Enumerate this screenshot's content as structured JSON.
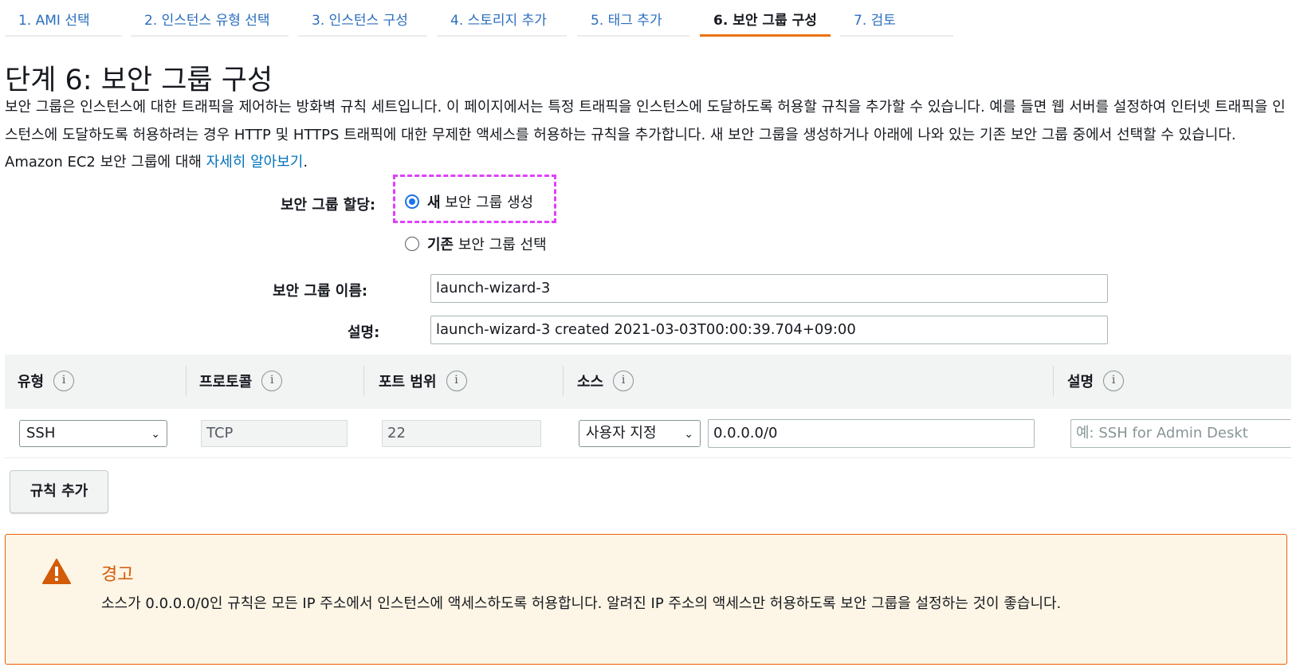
{
  "wizard": {
    "steps": [
      {
        "label": "1. AMI 선택",
        "active": false
      },
      {
        "label": "2. 인스턴스 유형 선택",
        "active": false
      },
      {
        "label": "3. 인스턴스 구성",
        "active": false
      },
      {
        "label": "4. 스토리지 추가",
        "active": false
      },
      {
        "label": "5. 태그 추가",
        "active": false
      },
      {
        "label": "6. 보안 그룹 구성",
        "active": true
      },
      {
        "label": "7. 검토",
        "active": false
      }
    ]
  },
  "page": {
    "title": "단계 6: 보안 그룹 구성",
    "description": "보안 그룹은 인스턴스에 대한 트래픽을 제어하는 방화벽 규칙 세트입니다. 이 페이지에서는 특정 트래픽을 인스턴스에 도달하도록 허용할 규칙을 추가할 수 있습니다. 예를 들면 웹 서버를 설정하여 인터넷 트래픽을 인스턴스에 도달하도록 허용하려는 경우 HTTP 및 HTTPS 트래픽에 대한 무제한 액세스를 허용하는 규칙을 추가합니다. 새 보안 그룹을 생성하거나 아래에 나와 있는 기존 보안 그룹 중에서 선택할 수 있습니다. Amazon EC2 보안 그룹에 대해 ",
    "learn_more": "자세히 알아보기",
    "learn_more_suffix": "."
  },
  "assign": {
    "label": "보안 그룹 할당:",
    "option_new_bold": "새",
    "option_new_rest": " 보안 그룹 생성",
    "option_existing_bold": "기존",
    "option_existing_rest": " 보안 그룹 선택",
    "selected": "new"
  },
  "group_name": {
    "label": "보안 그룹 이름:",
    "value": "launch-wizard-3"
  },
  "group_desc": {
    "label": "설명:",
    "value": "launch-wizard-3 created 2021-03-03T00:00:39.704+09:00"
  },
  "rules": {
    "columns": [
      "유형",
      "프로토콜",
      "포트 범위",
      "소스",
      "설명"
    ],
    "info_icon": "i",
    "rows": [
      {
        "type": "SSH",
        "protocol": "TCP",
        "port_range": "22",
        "source_mode": "사용자 지정",
        "source_cidr": "0.0.0.0/0",
        "description_placeholder": "예: SSH for Admin Deskt"
      }
    ]
  },
  "add_rule_label": "규칙 추가",
  "alert": {
    "title": "경고",
    "body": "소스가 0.0.0.0/0인 규칙은 모든 IP 주소에서 인스턴스에 액세스하도록 허용합니다. 알려진 IP 주소의 액세스만 허용하도록 보안 그룹을 설정하는 것이 좋습니다.",
    "icon": "warning-triangle-icon"
  },
  "colors": {
    "link": "#0073bb",
    "active_step": "#ec7211",
    "warning": "#d45b07",
    "highlight": "#e040fb"
  }
}
